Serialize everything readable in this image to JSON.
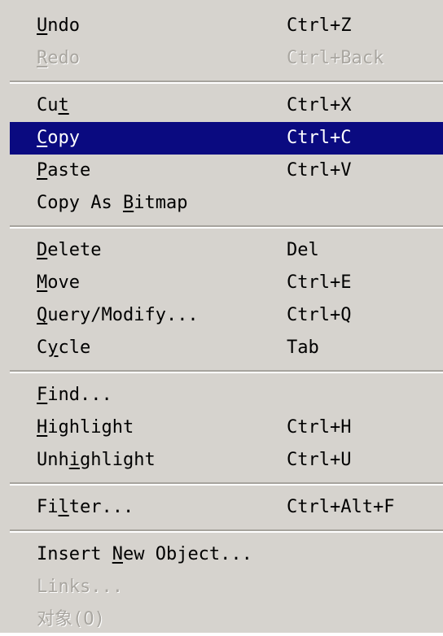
{
  "menu": {
    "groups": [
      [
        {
          "label": "Undo",
          "shortcut": "Ctrl+Z",
          "disabled": false,
          "selected": false,
          "accel": 0
        },
        {
          "label": "Redo",
          "shortcut": "Ctrl+Back",
          "disabled": true,
          "selected": false,
          "accel": 0
        }
      ],
      [
        {
          "label": "Cut",
          "shortcut": "Ctrl+X",
          "disabled": false,
          "selected": false,
          "accel": 2
        },
        {
          "label": "Copy",
          "shortcut": "Ctrl+C",
          "disabled": false,
          "selected": true,
          "accel": 0
        },
        {
          "label": "Paste",
          "shortcut": "Ctrl+V",
          "disabled": false,
          "selected": false,
          "accel": 0
        },
        {
          "label": "Copy As Bitmap",
          "shortcut": "",
          "disabled": false,
          "selected": false,
          "accel": 8
        }
      ],
      [
        {
          "label": "Delete",
          "shortcut": "Del",
          "disabled": false,
          "selected": false,
          "accel": 0
        },
        {
          "label": "Move",
          "shortcut": "Ctrl+E",
          "disabled": false,
          "selected": false,
          "accel": 0
        },
        {
          "label": "Query/Modify...",
          "shortcut": "Ctrl+Q",
          "disabled": false,
          "selected": false,
          "accel": 0
        },
        {
          "label": "Cycle",
          "shortcut": "Tab",
          "disabled": false,
          "selected": false,
          "accel": 1
        }
      ],
      [
        {
          "label": "Find...",
          "shortcut": "",
          "disabled": false,
          "selected": false,
          "accel": 0
        },
        {
          "label": "Highlight",
          "shortcut": "Ctrl+H",
          "disabled": false,
          "selected": false,
          "accel": 0
        },
        {
          "label": "Unhighlight",
          "shortcut": "Ctrl+U",
          "disabled": false,
          "selected": false,
          "accel": 3
        }
      ],
      [
        {
          "label": "Filter...",
          "shortcut": "Ctrl+Alt+F",
          "disabled": false,
          "selected": false,
          "accel": 2
        }
      ],
      [
        {
          "label": "Insert New Object...",
          "shortcut": "",
          "disabled": false,
          "selected": false,
          "accel": 7
        },
        {
          "label": "Links...",
          "shortcut": "",
          "disabled": true,
          "selected": false,
          "accel": -1
        },
        {
          "label": "对象(O)",
          "shortcut": "",
          "disabled": true,
          "selected": false,
          "accel": -1
        }
      ]
    ]
  }
}
